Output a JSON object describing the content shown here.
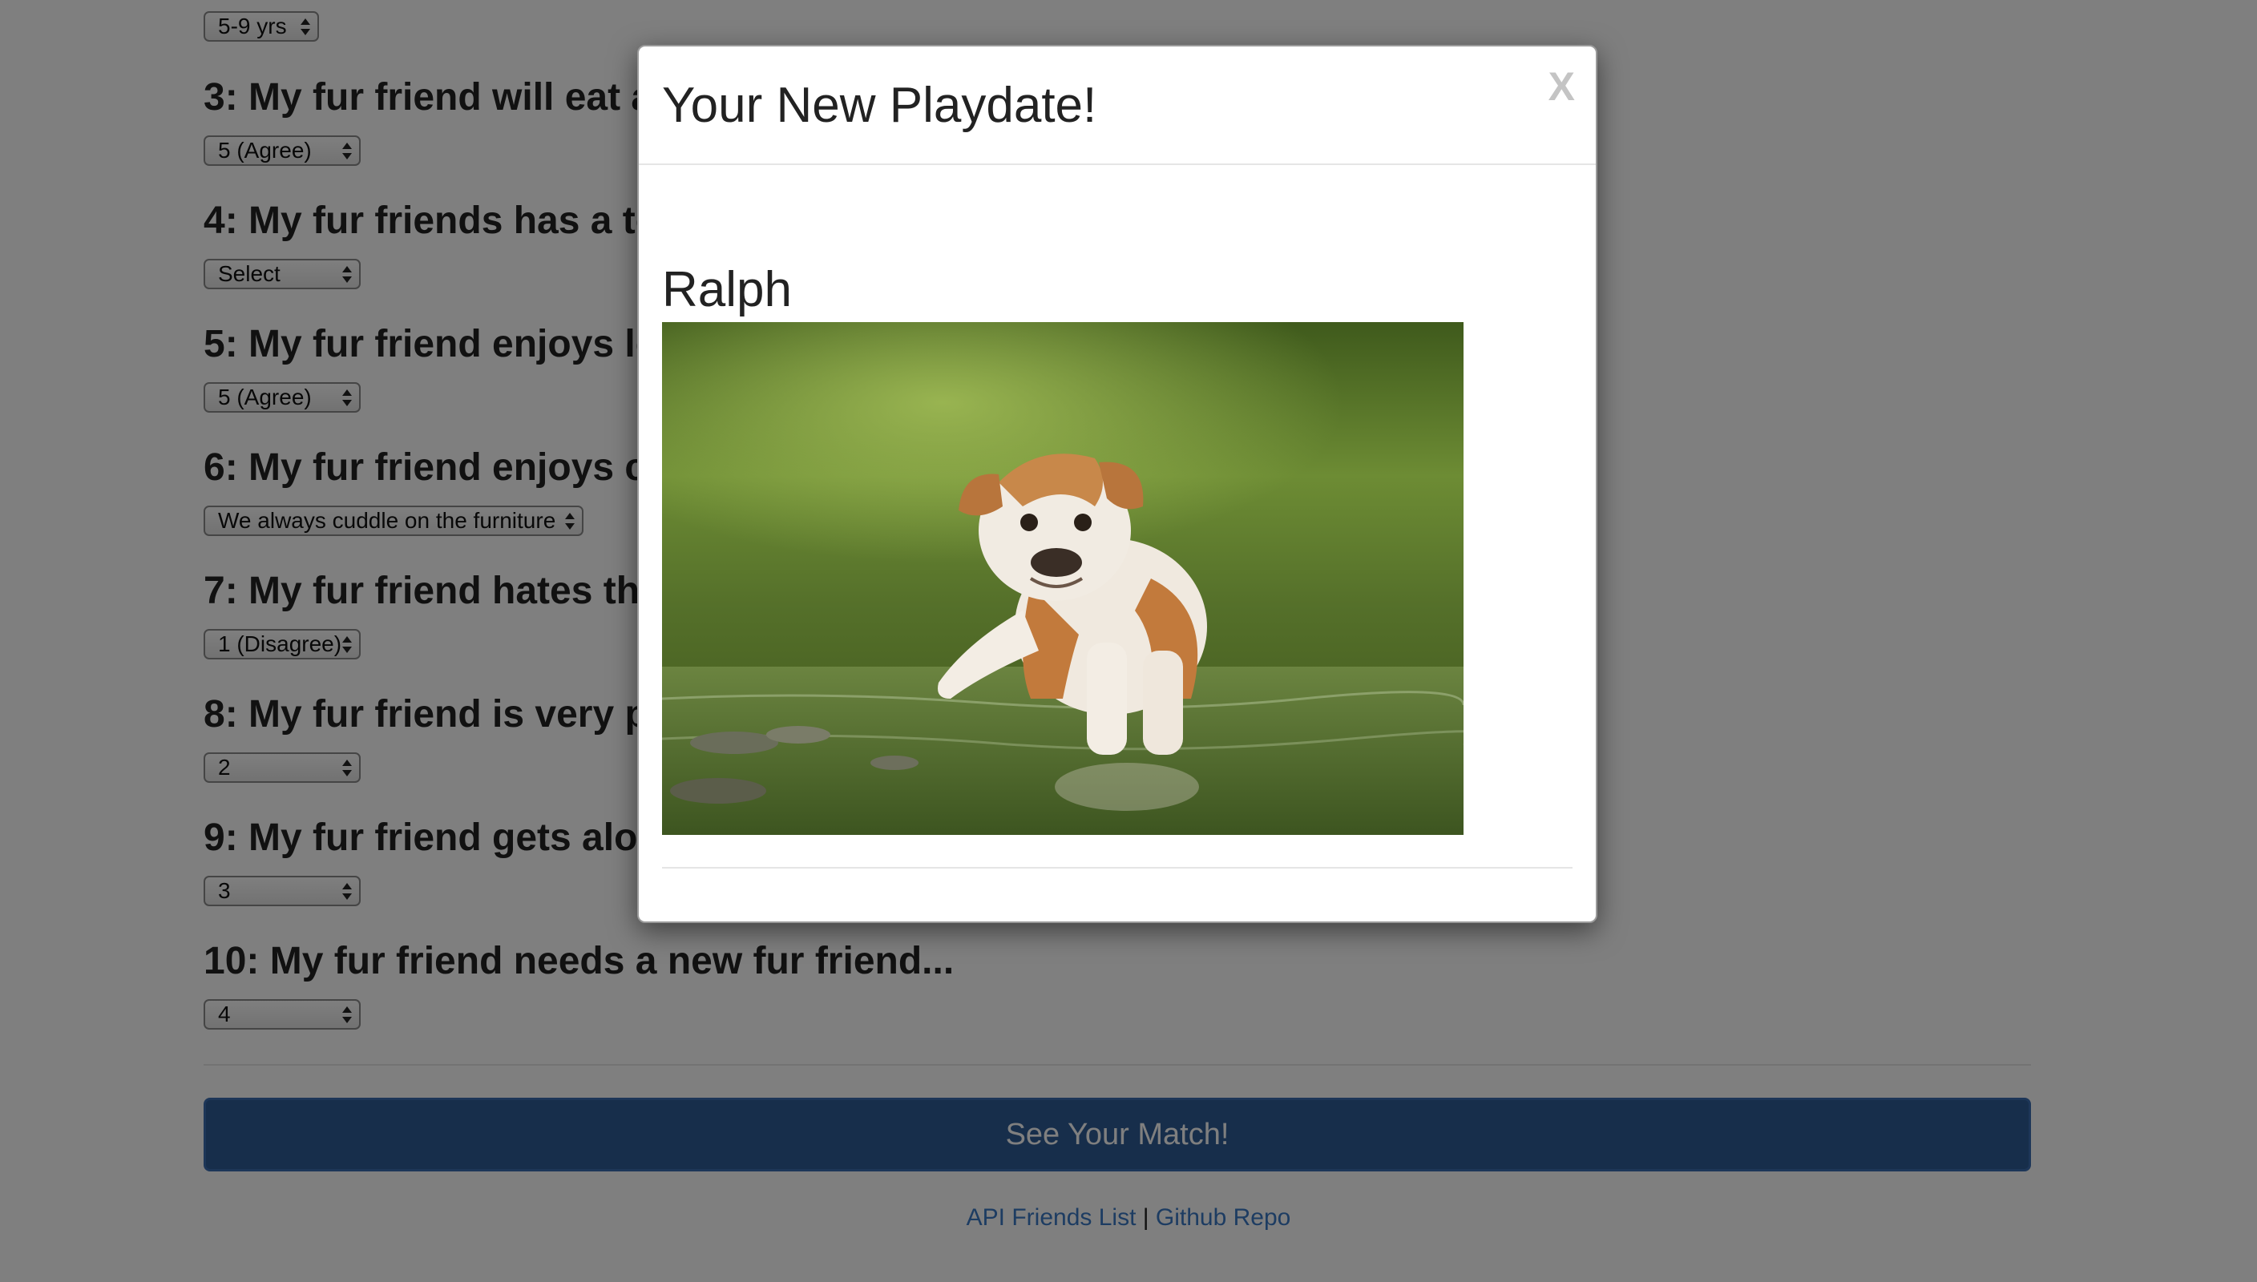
{
  "questions": [
    {
      "title": "",
      "answer": "5-9 yrs"
    },
    {
      "title": "3: My fur friend will eat a",
      "answer": "5 (Agree)"
    },
    {
      "title": "4: My fur friends has a to",
      "answer": "Select"
    },
    {
      "title": "5: My fur friend enjoys lo",
      "answer": "5 (Agree)"
    },
    {
      "title": "6: My fur friend enjoys cu",
      "answer": "We always cuddle on the furniture"
    },
    {
      "title": "7: My fur friend hates the",
      "answer": "1 (Disagree)"
    },
    {
      "title": "8: My fur friend is very pr",
      "answer": "2"
    },
    {
      "title": "9: My fur friend gets alon",
      "answer": "3"
    },
    {
      "title": "10: My fur friend needs a new fur friend...",
      "answer": "4"
    }
  ],
  "submit_label": "See Your Match!",
  "footer": {
    "link1": "API Friends List",
    "separator": "|",
    "link2": "Github Repo"
  },
  "modal": {
    "title": "Your New Playdate!",
    "close_label": "X",
    "match_name": "Ralph"
  }
}
